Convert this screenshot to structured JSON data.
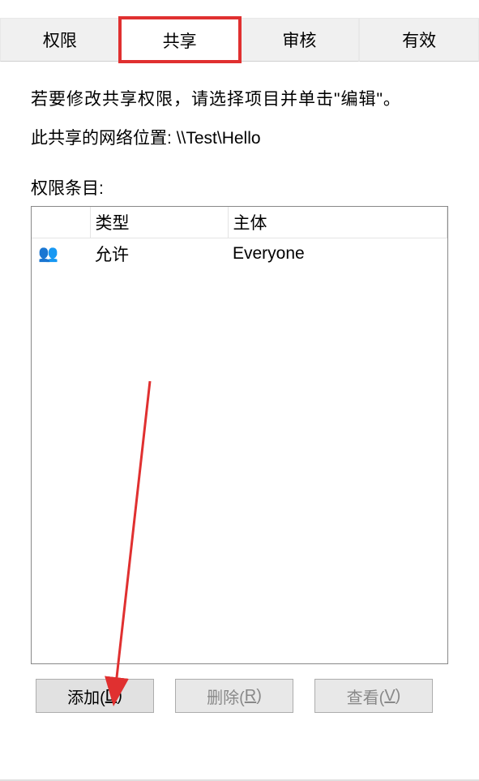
{
  "tabs": {
    "permissions": "权限",
    "share": "共享",
    "audit": "审核",
    "effective": "有效"
  },
  "content": {
    "instruction": "若要修改共享权限，请选择项目并单击\"编辑\"。",
    "network_location_label": "此共享的网络位置:",
    "network_location_value": "\\\\Test\\Hello",
    "permissions_label": "权限条目:"
  },
  "table": {
    "headers": {
      "type": "类型",
      "principal": "主体"
    },
    "rows": [
      {
        "type": "允许",
        "principal": "Everyone"
      }
    ]
  },
  "buttons": {
    "add_text": "添加(",
    "add_key": "D",
    "add_suffix": ")",
    "remove_text": "删除(",
    "remove_key": "R",
    "remove_suffix": ")",
    "view_text": "查看(",
    "view_key": "V",
    "view_suffix": ")"
  }
}
